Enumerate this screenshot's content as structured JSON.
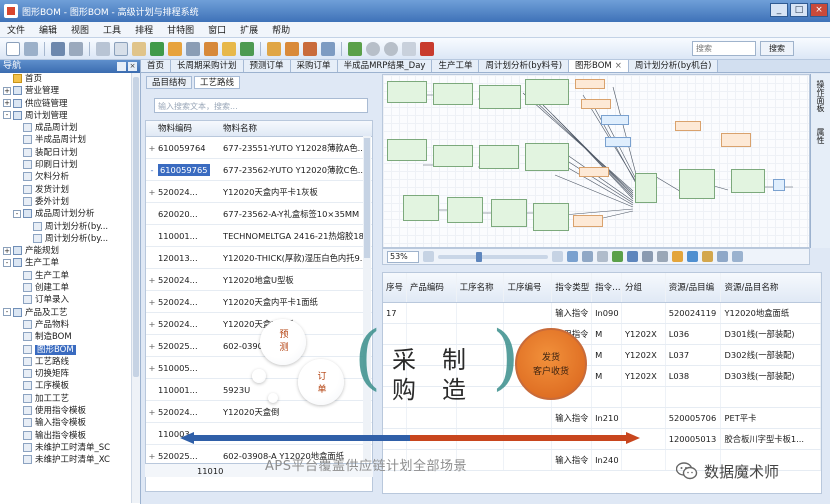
{
  "window": {
    "title": "图形BOM - 图形BOM - 高级计划与排程系统",
    "buttons": [
      "_",
      "□",
      "×"
    ]
  },
  "menu": [
    "文件",
    "编辑",
    "视图",
    "工具",
    "排程",
    "甘特图",
    "窗口",
    "扩展",
    "帮助"
  ],
  "toolbar": {
    "search_placeholder": "搜索",
    "search_button": "搜索"
  },
  "nav": {
    "title": "导航",
    "items": [
      {
        "label": "首页",
        "level": 0,
        "toggle": "",
        "icon": "home-icon"
      },
      {
        "label": "营业管理",
        "level": 0,
        "toggle": "+",
        "icon": "folder-icon"
      },
      {
        "label": "供应链管理",
        "level": 0,
        "toggle": "+",
        "icon": "folder-icon"
      },
      {
        "label": "周计划管理",
        "level": 0,
        "toggle": "-",
        "icon": "folder-icon"
      },
      {
        "label": "成品周计划",
        "level": 1,
        "toggle": "",
        "icon": "leaf-icon"
      },
      {
        "label": "半成品周计划",
        "level": 1,
        "toggle": "",
        "icon": "leaf-icon"
      },
      {
        "label": "装配日计划",
        "level": 1,
        "toggle": "",
        "icon": "leaf-icon"
      },
      {
        "label": "印刷日计划",
        "level": 1,
        "toggle": "",
        "icon": "leaf-icon"
      },
      {
        "label": "欠料分析",
        "level": 1,
        "toggle": "",
        "icon": "leaf-icon"
      },
      {
        "label": "发货计划",
        "level": 1,
        "toggle": "",
        "icon": "leaf-icon"
      },
      {
        "label": "委外计划",
        "level": 1,
        "toggle": "",
        "icon": "leaf-icon"
      },
      {
        "label": "成品周计划分析",
        "level": 1,
        "toggle": "-",
        "icon": "folder-icon"
      },
      {
        "label": "周计划分析(by...",
        "level": 2,
        "toggle": "",
        "icon": "leaf-icon"
      },
      {
        "label": "周计划分析(by...",
        "level": 2,
        "toggle": "",
        "icon": "leaf-icon"
      },
      {
        "label": "产能规划",
        "level": 0,
        "toggle": "+",
        "icon": "folder-icon"
      },
      {
        "label": "生产工单",
        "level": 0,
        "toggle": "-",
        "icon": "folder-icon"
      },
      {
        "label": "生产工单",
        "level": 1,
        "toggle": "",
        "icon": "leaf-icon"
      },
      {
        "label": "创建工单",
        "level": 1,
        "toggle": "",
        "icon": "leaf-icon"
      },
      {
        "label": "订单录入",
        "level": 1,
        "toggle": "",
        "icon": "leaf-icon"
      },
      {
        "label": "产品及工艺",
        "level": 0,
        "toggle": "-",
        "icon": "folder-icon"
      },
      {
        "label": "产品物料",
        "level": 1,
        "toggle": "",
        "icon": "leaf-icon"
      },
      {
        "label": "制造BOM",
        "level": 1,
        "toggle": "",
        "icon": "leaf-icon"
      },
      {
        "label": "图形BOM",
        "level": 1,
        "toggle": "",
        "icon": "leaf-icon",
        "selected": true
      },
      {
        "label": "工艺路线",
        "level": 1,
        "toggle": "",
        "icon": "leaf-icon"
      },
      {
        "label": "切换矩阵",
        "level": 1,
        "toggle": "",
        "icon": "leaf-icon"
      },
      {
        "label": "工序模板",
        "level": 1,
        "toggle": "",
        "icon": "leaf-icon"
      },
      {
        "label": "加工工艺",
        "level": 1,
        "toggle": "",
        "icon": "leaf-icon"
      },
      {
        "label": "使用指令模板",
        "level": 1,
        "toggle": "",
        "icon": "leaf-icon"
      },
      {
        "label": "输入指令模板",
        "level": 1,
        "toggle": "",
        "icon": "leaf-icon"
      },
      {
        "label": "输出指令模板",
        "level": 1,
        "toggle": "",
        "icon": "leaf-icon"
      },
      {
        "label": "未维护工时清单_SC",
        "level": 1,
        "toggle": "",
        "icon": "leaf-icon"
      },
      {
        "label": "未维护工时清单_XC",
        "level": 1,
        "toggle": "",
        "icon": "leaf-icon"
      }
    ]
  },
  "tabs": [
    {
      "label": "首页",
      "active": false
    },
    {
      "label": "长周期采购计划",
      "active": false
    },
    {
      "label": "预测订单",
      "active": false
    },
    {
      "label": "采购订单",
      "active": false
    },
    {
      "label": "半成品MRP结果_Day",
      "active": false
    },
    {
      "label": "生产工单",
      "active": false
    },
    {
      "label": "周计划分析(by料号)",
      "active": false
    },
    {
      "label": "图形BOM",
      "active": true,
      "close": "×"
    },
    {
      "label": "周计划分析(by机台)",
      "active": false
    }
  ],
  "subtabs": [
    {
      "label": "品目结构",
      "active": false
    },
    {
      "label": "工艺路线",
      "active": true
    }
  ],
  "item_search_placeholder": "输入搜索文本，搜索...",
  "item_grid": {
    "columns": [
      "物料编码",
      "物料名称"
    ],
    "rows": [
      {
        "toggle": "+",
        "code": "610059764",
        "name": "677-23551-YUTO Y12028薄款A色...",
        "selected": false
      },
      {
        "toggle": "-",
        "code": "610059765",
        "name": "677-23562-YUTO Y12020薄款C色...",
        "selected": true
      },
      {
        "toggle": "+",
        "code": "520024...",
        "name": "Y12020天盒内平卡1灰板",
        "selected": false
      },
      {
        "toggle": "",
        "code": "620020...",
        "name": "677-23562-A-Y礼盒标签10×35MM",
        "selected": false
      },
      {
        "toggle": "",
        "code": "110001...",
        "name": "TECHNOMELTGA 2416-21热熔胶18...",
        "selected": false
      },
      {
        "toggle": "",
        "code": "120013...",
        "name": "Y12020-THICK(厚款)湿压白色内托9...",
        "selected": false
      },
      {
        "toggle": "+",
        "code": "520024...",
        "name": "Y12020地盒U型板",
        "selected": false
      },
      {
        "toggle": "+",
        "code": "520024...",
        "name": "Y12020天盒内平卡1面纸",
        "selected": false
      },
      {
        "toggle": "+",
        "code": "520024...",
        "name": "Y12020天盒U型板",
        "selected": false
      },
      {
        "toggle": "+",
        "code": "520025...",
        "name": "602-03903-A...",
        "selected": false
      },
      {
        "toggle": "+",
        "code": "510005...",
        "name": "",
        "selected": false
      },
      {
        "toggle": "",
        "code": "110001...",
        "name": "5923U",
        "selected": false
      },
      {
        "toggle": "+",
        "code": "520024...",
        "name": "Y12020天盒倒",
        "selected": false
      },
      {
        "toggle": "",
        "code": "110003...",
        "name": "",
        "selected": false
      },
      {
        "toggle": "+",
        "code": "520025...",
        "name": "602-03908-A Y12020地盒面纸",
        "selected": false
      }
    ],
    "footer": "11010"
  },
  "diagram": {
    "zoom": "53%",
    "right_dock": [
      "操作面板",
      "属性"
    ]
  },
  "instr_grid": {
    "columns": [
      "序号",
      "产品编码",
      "工序名称",
      "工序编号",
      "指令类型",
      "指令…",
      "分组",
      "资源/品目编码",
      "资源/品目名称"
    ],
    "rows": [
      [
        "17",
        "",
        "",
        "",
        "输入指令",
        "In090",
        "",
        "520024119",
        "Y12020地盒面纸"
      ],
      [
        "",
        "",
        "",
        "",
        "使用指令",
        "M",
        "Y1202X",
        "L036",
        "D301线(一部装配)"
      ],
      [
        "",
        "",
        "",
        "",
        "",
        "M",
        "Y1202X",
        "L037",
        "D302线(一部装配)"
      ],
      [
        "",
        "",
        "",
        "",
        "",
        "M",
        "Y1202X",
        "L038",
        "D303线(一部装配)"
      ],
      [
        "",
        "",
        "",
        "",
        "",
        "",
        "",
        "",
        ""
      ],
      [
        "",
        "",
        "",
        "",
        "输入指令",
        "In210",
        "",
        "520005706",
        "PET平卡"
      ],
      [
        "",
        "",
        "",
        "",
        "",
        "",
        "",
        "120005013",
        "胶合板川字型卡板1..."
      ],
      [
        "",
        "",
        "",
        "",
        "输入指令",
        "In240",
        "",
        "",
        ""
      ]
    ]
  },
  "overlay": {
    "bubble_top": "预\n测",
    "bubble_bottom": "订\n单",
    "word_left": "采\n购",
    "word_right": "制\n造",
    "orange_circle": "发货\n客户收货",
    "caption": "APS平台覆盖供应链计划全部场景",
    "watermark": "数据魔术师"
  },
  "colors": {
    "title_bar": "#3f72b8",
    "selection": "#3a6bc0",
    "arrow_left": "#2f5fa8",
    "arrow_right": "#c8461e",
    "paren": "#3a8f8c",
    "orange": "#e07a2a"
  }
}
